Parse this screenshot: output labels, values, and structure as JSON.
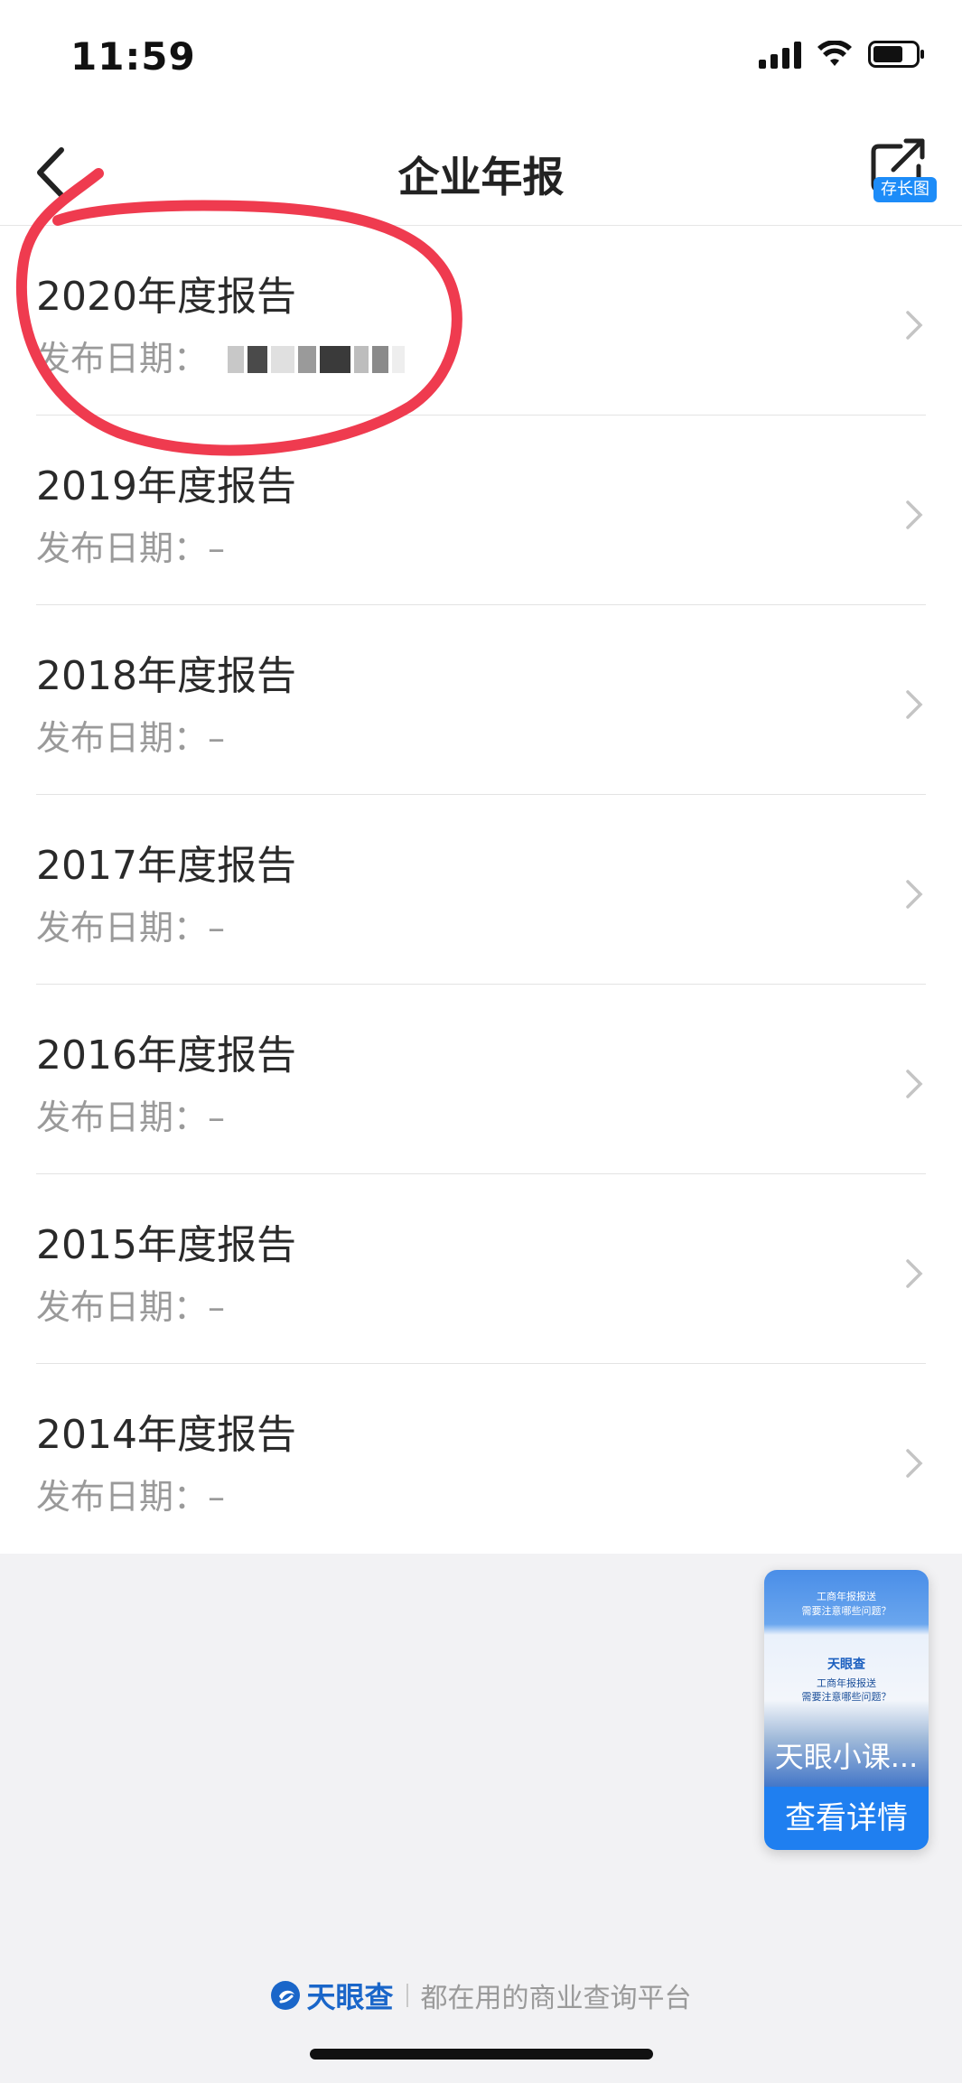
{
  "status_bar": {
    "time": "11:59"
  },
  "nav": {
    "title": "企业年报",
    "share_badge": "存长图"
  },
  "reports": [
    {
      "title": "2020年度报告",
      "date_label": "发布日期：",
      "date_value": ""
    },
    {
      "title": "2019年度报告",
      "date_label": "发布日期：",
      "date_value": "–"
    },
    {
      "title": "2018年度报告",
      "date_label": "发布日期：",
      "date_value": "–"
    },
    {
      "title": "2017年度报告",
      "date_label": "发布日期：",
      "date_value": "–"
    },
    {
      "title": "2016年度报告",
      "date_label": "发布日期：",
      "date_value": "–"
    },
    {
      "title": "2015年度报告",
      "date_label": "发布日期：",
      "date_value": "–"
    },
    {
      "title": "2014年度报告",
      "date_label": "发布日期：",
      "date_value": "–"
    }
  ],
  "float_card": {
    "headline": "工商年报报送\n需要注意哪些问题？",
    "logo": "天眼查",
    "sub_headline": "工商年报报送\n需要注意哪些问题？",
    "name": "天眼小课...",
    "button": "查看详情"
  },
  "footer": {
    "brand": "天眼查",
    "slogan": "都在用的商业查询平台"
  },
  "colors": {
    "accent": "#1f7ff0",
    "annotation": "#ef3b4f",
    "background": "#f2f2f4"
  }
}
